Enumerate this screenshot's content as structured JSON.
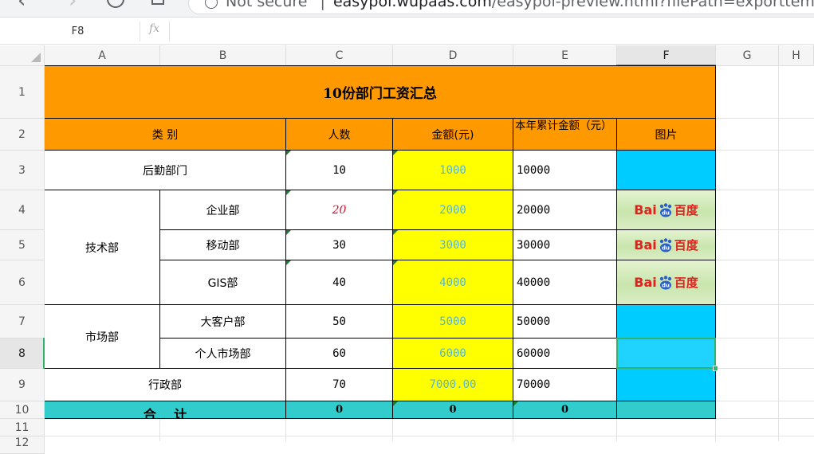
{
  "browser": {
    "security_label": "Not secure",
    "url_host": "easypoi.wupaas.com",
    "url_rest": "/easypoi-preview.html?filePath=exporttemp_img."
  },
  "formula_bar": {
    "name_box": "F8",
    "fx_label": "fx",
    "formula": ""
  },
  "columns": [
    "A",
    "B",
    "C",
    "D",
    "E",
    "F",
    "G",
    "H"
  ],
  "rows": [
    "1",
    "2",
    "3",
    "4",
    "5",
    "6",
    "7",
    "8",
    "9",
    "10",
    "11",
    "12"
  ],
  "sheet": {
    "title": "10份部门工资汇总",
    "headers": {
      "category": "类 别",
      "people": "人数",
      "amount": "金额(元)",
      "ytd": "本年累计金额（元）",
      "picture": "图片"
    },
    "rows": {
      "logistics": {
        "label": "后勤部门",
        "people": "10",
        "amount": "1000",
        "ytd": "10000"
      },
      "tech": {
        "label": "技术部",
        "enterprise": {
          "label": "企业部",
          "people": "20",
          "amount": "2000",
          "ytd": "20000"
        },
        "mobile": {
          "label": "移动部",
          "people": "30",
          "amount": "3000",
          "ytd": "30000"
        },
        "gis": {
          "label": "GIS部",
          "people": "40",
          "amount": "4000",
          "ytd": "40000"
        }
      },
      "market": {
        "label": "市场部",
        "key_account": {
          "label": "大客户部",
          "people": "50",
          "amount": "5000",
          "ytd": "50000"
        },
        "personal": {
          "label": "个人市场部",
          "people": "60",
          "amount": "6000",
          "ytd": "60000"
        }
      },
      "admin": {
        "label": "行政部",
        "people": "70",
        "amount": "7000.00",
        "ytd": "70000"
      },
      "total": {
        "label": "合    计",
        "people": "0",
        "amount": "0",
        "ytd": "0"
      }
    },
    "logo": {
      "latin": "Bai",
      "cn": "百度",
      "icon": "baidu-paw-icon"
    }
  },
  "colors": {
    "header_orange": "#ff9900",
    "amount_yellow": "#ffff00",
    "picture_cyan": "#00ccff",
    "total_teal": "#33cccc",
    "selection_green": "#2fb36d"
  }
}
